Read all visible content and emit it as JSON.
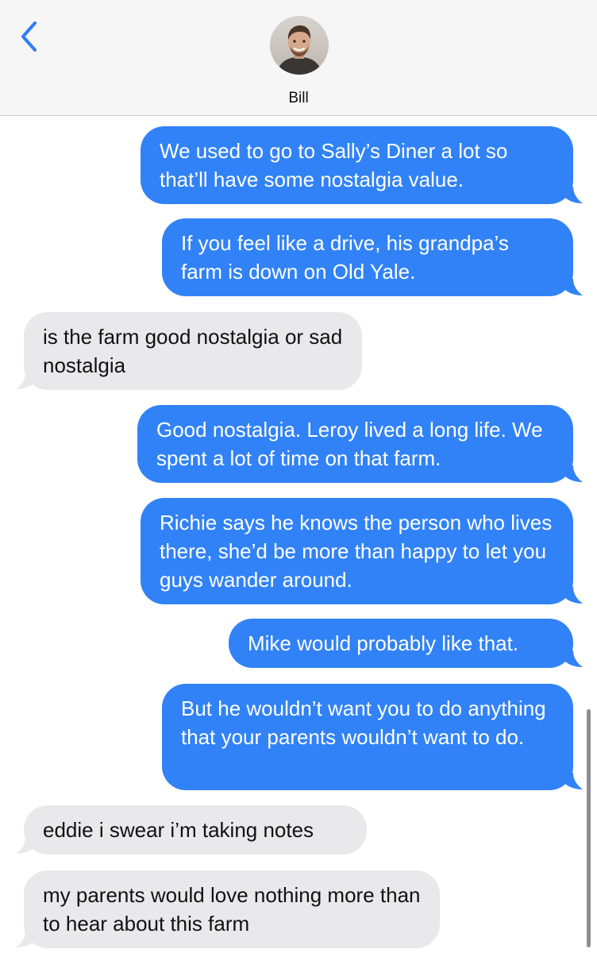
{
  "header": {
    "contact_name": "Bill"
  },
  "messages": [
    {
      "direction": "sent",
      "text": "We used to go to Sally’s Diner a lot so that’ll have some nostalgia value."
    },
    {
      "direction": "sent",
      "text": "If you feel like a drive, his grandpa’s farm is down on Old Yale."
    },
    {
      "direction": "received",
      "text": "is the farm good nostalgia or sad nostalgia"
    },
    {
      "direction": "sent",
      "text": "Good nostalgia. Leroy lived a long life. We spent a lot of time on that farm."
    },
    {
      "direction": "sent",
      "text": "Richie says he knows the person who lives there, she’d be more than happy to let you guys wander around."
    },
    {
      "direction": "sent",
      "text": "Mike would probably like that."
    },
    {
      "direction": "sent",
      "text": "But he wouldn’t want you to do anything that your parents wouldn’t want to do."
    },
    {
      "direction": "received",
      "text": "eddie i swear i’m taking notes"
    },
    {
      "direction": "received",
      "text": "my parents would love nothing more than to hear about this farm"
    }
  ],
  "colors": {
    "sent_bubble": "#3182f6",
    "received_bubble": "#e9e9eb",
    "accent": "#2f7df6",
    "header_background": "#f6f6f6"
  },
  "icons": {
    "back": "chevron-left-icon",
    "avatar": "contact-avatar"
  }
}
